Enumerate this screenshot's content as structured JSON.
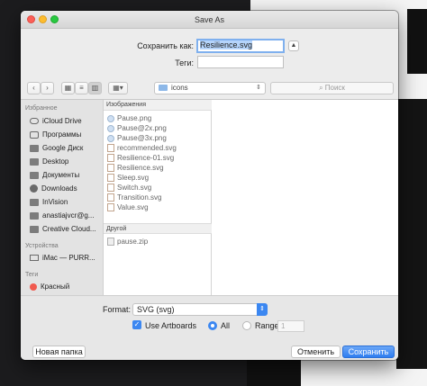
{
  "dialog": {
    "title": "Save As"
  },
  "save": {
    "name_label": "Сохранить как:",
    "filename": "Resilience.svg",
    "tags_label": "Теги:",
    "tags_value": ""
  },
  "toolbar": {
    "back": "‹",
    "forward": "›",
    "location": "icons",
    "search_placeholder": "Поиск"
  },
  "sidebar": {
    "favorites_header": "Избранное",
    "favorites": [
      {
        "label": "iCloud Drive",
        "icon": "cloud-icon"
      },
      {
        "label": "Программы",
        "icon": "applications-icon"
      },
      {
        "label": "Google Диск",
        "icon": "folder-icon"
      },
      {
        "label": "Desktop",
        "icon": "folder-icon"
      },
      {
        "label": "Документы",
        "icon": "folder-icon"
      },
      {
        "label": "Downloads",
        "icon": "download-icon"
      },
      {
        "label": "InVision",
        "icon": "folder-icon"
      },
      {
        "label": "anastiajvcr@g...",
        "icon": "folder-icon"
      },
      {
        "label": "Creative Cloud...",
        "icon": "folder-icon"
      }
    ],
    "devices_header": "Устройства",
    "devices": [
      {
        "label": "iMac — PURR...",
        "icon": "computer-icon"
      }
    ],
    "tags_header": "Теги",
    "tags": [
      {
        "label": "Красный",
        "color": "#f05a4f"
      }
    ]
  },
  "files": {
    "images_header": "Изображения",
    "images": [
      {
        "name": "Pause.png",
        "type": "png"
      },
      {
        "name": "Pause@2x.png",
        "type": "png"
      },
      {
        "name": "Pause@3x.png",
        "type": "png"
      },
      {
        "name": "recommended.svg",
        "type": "svg"
      },
      {
        "name": "Resilience-01.svg",
        "type": "svg"
      },
      {
        "name": "Resilience.svg",
        "type": "svg"
      },
      {
        "name": "Sleep.svg",
        "type": "svg"
      },
      {
        "name": "Switch.svg",
        "type": "svg"
      },
      {
        "name": "Transition.svg",
        "type": "svg"
      },
      {
        "name": "Value.svg",
        "type": "svg"
      }
    ],
    "other_header": "Другой",
    "other": [
      {
        "name": "pause.zip",
        "type": "zip"
      }
    ]
  },
  "options": {
    "format_label": "Format:",
    "format_value": "SVG (svg)",
    "use_artboards_label": "Use Artboards",
    "use_artboards_checked": true,
    "all_label": "All",
    "range_label": "Range:",
    "range_value": "1",
    "selected_scope": "All"
  },
  "buttons": {
    "new_folder": "Новая папка",
    "cancel": "Отменить",
    "save": "Сохранить"
  },
  "colors": {
    "accent": "#3b87f1",
    "tag_red": "#f05a4f"
  }
}
